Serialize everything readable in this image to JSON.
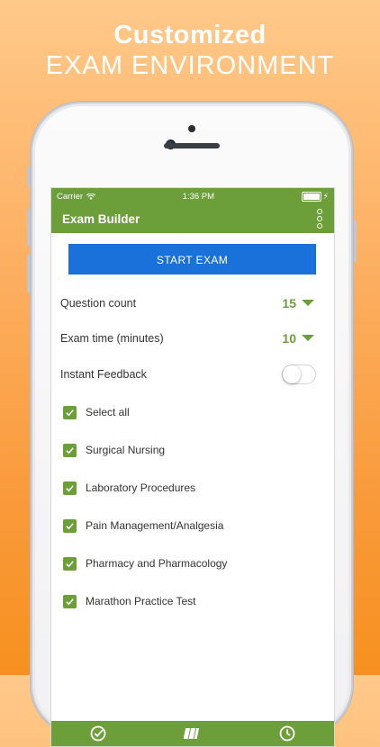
{
  "promo": {
    "line1": "Customized",
    "line2": "EXAM ENVIRONMENT"
  },
  "statusbar": {
    "carrier": "Carrier",
    "time": "1:36 PM"
  },
  "toolbar": {
    "title": "Exam Builder",
    "menu_icon": "more-vertical-icon"
  },
  "start_button": {
    "label": "START EXAM"
  },
  "settings": {
    "question_count": {
      "label": "Question count",
      "value": "15"
    },
    "exam_time": {
      "label": "Exam time (minutes)",
      "value": "10"
    },
    "instant_feedback": {
      "label": "Instant Feedback",
      "enabled": false
    }
  },
  "categories": [
    {
      "label": "Select all",
      "checked": true
    },
    {
      "label": "Surgical Nursing",
      "checked": true
    },
    {
      "label": "Laboratory Procedures",
      "checked": true
    },
    {
      "label": "Pain Management/Analgesia",
      "checked": true
    },
    {
      "label": "Pharmacy and Pharmacology",
      "checked": true
    },
    {
      "label": "Marathon Practice Test",
      "checked": true
    }
  ],
  "bottom_tabs": [
    {
      "icon": "check-circle-icon"
    },
    {
      "icon": "cards-icon"
    },
    {
      "icon": "clock-icon"
    }
  ],
  "colors": {
    "accent": "#6c9e3a",
    "primary_button": "#1a71d9",
    "background_top": "#ffc98a",
    "background_bottom": "#f7901f"
  }
}
